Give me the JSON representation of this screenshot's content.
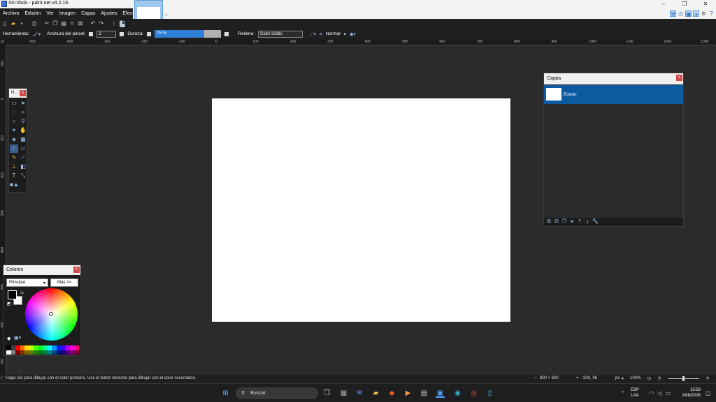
{
  "window": {
    "title": "Sin título - paint.net v4.2.16"
  },
  "menu": [
    "Archivo",
    "Edición",
    "Ver",
    "Imagen",
    "Capas",
    "Ajustes",
    "Efectos"
  ],
  "toolbar2": {
    "tool_label": "Herramienta:",
    "brush_width_label": "Anchura del pincel:",
    "brush_width_value": "2",
    "hardness_label": "Dureza:",
    "hardness_value": "75 %",
    "hardness_level": 0.75,
    "fill_label": "Relleno:",
    "fill_value": "Color sólido",
    "blend_value": "Normal"
  },
  "ruler": {
    "top_ticks": [
      "-500",
      "-400",
      "-300",
      "-200",
      "-100",
      "0",
      "100",
      "200",
      "300",
      "400",
      "500",
      "600",
      "700",
      "800",
      "900",
      "1000",
      "1100",
      "1200",
      "1300"
    ],
    "left_ticks": [
      "100",
      "0",
      "100",
      "200",
      "300",
      "400",
      "500",
      "600",
      "700"
    ],
    "unit": "px"
  },
  "tools_panel": {
    "title": "H..."
  },
  "colors_panel": {
    "title": "Colores",
    "mode": "Principal",
    "more_button": "Más >>",
    "primary_color": "#000000",
    "secondary_color": "#ffffff"
  },
  "layers_panel": {
    "title": "Capas",
    "layers": [
      {
        "name": "Fondo"
      }
    ]
  },
  "status": {
    "hint": "Haga clic para dibujar con el color primario. Use el botón derecho para dibujar con el color secundario.",
    "image_size": "800 × 600",
    "cursor_pos": "-300, 96",
    "unit": "px",
    "zoom": "100%"
  },
  "taskbar": {
    "search_placeholder": "Buscar",
    "lang": "ESP",
    "lang2": "LAA",
    "time": "15:59",
    "date": "24/8/2026"
  }
}
